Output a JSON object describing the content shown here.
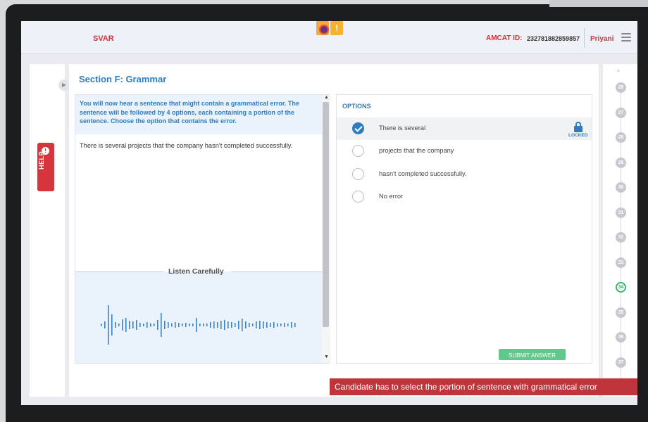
{
  "header": {
    "brand": "SVAR",
    "amcat_label": "AMCAT ID:",
    "amcat_id": "232781882859857",
    "user_name": "Priyani"
  },
  "help": {
    "label": "HELP"
  },
  "section": {
    "title": "Section F: Grammar"
  },
  "question": {
    "instructions": "You will now hear a sentence that might contain a grammatical error. The sentence will be followed by 4 options, each containing a portion of the sentence. Choose the option that contains the error.",
    "sentence": "There is several projects that the company hasn't completed successfully.",
    "listen_label": "Listen Carefully"
  },
  "options": {
    "title": "OPTIONS",
    "items": [
      {
        "label": "There is several",
        "selected": true
      },
      {
        "label": "projects that the company",
        "selected": false
      },
      {
        "label": "hasn't completed successfully.",
        "selected": false
      },
      {
        "label": "No error",
        "selected": false
      }
    ],
    "locked_label": "LOCKED"
  },
  "submit": {
    "label": "SUBMIT ANSWER"
  },
  "caption": "Candidate has to select the portion of sentence with grammatical error",
  "question_nav": {
    "numbers": [
      "26",
      "27",
      "28",
      "29",
      "30",
      "31",
      "32",
      "33",
      "34",
      "35",
      "36",
      "37"
    ],
    "current": "34"
  },
  "icons": {
    "menu": "hamburger-icon",
    "help": "info-icon",
    "lock": "lock-icon",
    "expand": "chevron-right-icon"
  },
  "colors": {
    "accent_blue": "#2f7cc0",
    "brand_red": "#d0333a",
    "current_green": "#3ab86b",
    "submit_green": "#5fc98b"
  }
}
